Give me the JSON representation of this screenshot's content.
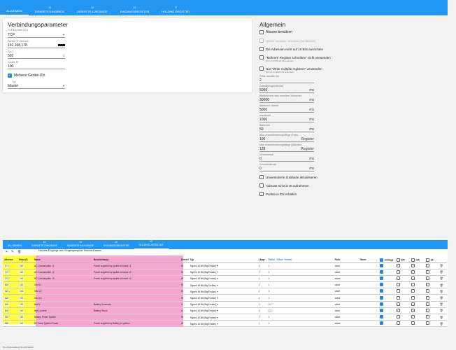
{
  "top_tabs": [
    {
      "label": "ALLGEMEIN",
      "count": "",
      "active": true
    },
    {
      "label": "DISKRETE EINGÄNGE",
      "count": "10",
      "active": false
    },
    {
      "label": "DISKRETE AUSGÄNGE",
      "count": "10",
      "active": false
    },
    {
      "label": "EINGANGSREGISTER",
      "count": "10",
      "active": false
    },
    {
      "label": "HOLDING-REGISTER",
      "count": "12",
      "active": false
    }
  ],
  "connection": {
    "title": "Verbindungsparameter",
    "subtitle": "TCP/Encoder RTU",
    "type_value": "TCP",
    "ip_label": "Partner IP-Adresse",
    "ip_value": "192.168.178.",
    "port_label": "Port",
    "port_value": "502",
    "device_label": "Geräte ID",
    "device_value": "100",
    "multi_label": "Mehrere Geräte-IDs",
    "type2_label": "Typ",
    "type2_value": "Master"
  },
  "general": {
    "title": "Allgemein",
    "aliases": "Aliasse benutzen",
    "direct": "Direkte Adressen benutzen (bei Aliasse)",
    "align": "Die Adressen nicht auf 16 Bits ausrichten",
    "multi_write": "\"Mehrere Register schreiben\" nicht verwenden",
    "multi_write_note": "Nur mit FC5/FC16 verwenden",
    "only_write": "Nur \"Write multiple registers\" verwenden",
    "only_write_note": "Nur mit FC15/FC16 schreiben",
    "fields": [
      {
        "label": "Fehler senden bei",
        "value": "2",
        "unit": ""
      },
      {
        "label": "Datenabfrageintervall",
        "value": "5000",
        "unit": "ms"
      },
      {
        "label": "Wiederholen nach erneuten Versuchen",
        "value": "30000",
        "unit": "ms"
      },
      {
        "label": "Wartezeit Lesend",
        "value": "5000",
        "unit": "ms"
      },
      {
        "label": "Impulszeit",
        "value": "1000",
        "unit": "ms"
      },
      {
        "label": "Wartezeit",
        "value": "50",
        "unit": "ms"
      },
      {
        "label": "Max Leseanforderungslänge (Polls)",
        "value": "100",
        "unit": "Register"
      },
      {
        "label": "Max Leseanforderungslänge (Bitbreite)",
        "value": "128",
        "unit": "Register"
      },
      {
        "label": "Umrechnend",
        "value": "0",
        "unit": "ms"
      },
      {
        "label": "Schreibintervall",
        "value": "0",
        "unit": "ms"
      }
    ],
    "unchanged": "Unveränderte Zustände aktualisieren",
    "no_address": "Adresse nicht in ID aufnehmen",
    "points": "Punkte in IDs erhalten"
  },
  "bottom_tabs": [
    {
      "label": "ALLGEMEIN",
      "count": "",
      "active": false
    },
    {
      "label": "DISKRETE EINGÄNGE",
      "count": "10",
      "active": false
    },
    {
      "label": "DISKRETE AUSGÄNGE",
      "count": "10",
      "active": false
    },
    {
      "label": "EINGANGSREGISTER",
      "count": "10",
      "active": false
    },
    {
      "label": "HOLDING-REGISTER",
      "count": "12",
      "active": true
    }
  ],
  "toolbar": {
    "add": "+",
    "edit": "✎",
    "delete": "🗑",
    "label": "Diskrete Eingänge bzw. Eingangsregister Standard lassen"
  },
  "columns": [
    "Adresse",
    "Slave-ID",
    "Name",
    "Beschreibung",
    "Einheit",
    "Typ",
    "Länge",
    "Faktor",
    "Offset",
    "Formel",
    "Rolle",
    "Raum",
    "Umfrage",
    "WP",
    "CW",
    "SF"
  ],
  "rows": [
    {
      "addr": "371",
      "slave": "100",
      "name": "AC Consumption L1",
      "desc": "Power supplied by system to loads L1",
      "unit": "W",
      "type": "Signed 16 Bit (Big Endian)",
      "len": "1",
      "factor": "1"
    },
    {
      "addr": "372",
      "slave": "100",
      "name": "AC Consumption L2",
      "desc": "Power supplied by system to loads L2",
      "unit": "W",
      "type": "Signed 16 Bit (Big Endian)",
      "len": "1",
      "factor": "1"
    },
    {
      "addr": "373",
      "slave": "100",
      "name": "AC Consumption L3",
      "desc": "Power supplied by system to loads L3",
      "unit": "W",
      "type": "Signed 16 Bit (Big Endian)",
      "len": "1",
      "factor": "1"
    },
    {
      "addr": "820",
      "slave": "100",
      "name": "Grid L1",
      "desc": "",
      "unit": "W",
      "type": "Signed 16 Bit (Big Endian)",
      "len": "1",
      "factor": "1"
    },
    {
      "addr": "821",
      "slave": "100",
      "name": "Grid L2",
      "desc": "",
      "unit": "W",
      "type": "Signed 16 Bit (Big Endian)",
      "len": "1",
      "factor": "1"
    },
    {
      "addr": "822",
      "slave": "100",
      "name": "Grid L3",
      "desc": "",
      "unit": "W",
      "type": "Signed 16 Bit (Big Endian)",
      "len": "1",
      "factor": "1"
    },
    {
      "addr": "840",
      "slave": "100",
      "name": "Batt V",
      "desc": "Battery Summary",
      "unit": "V",
      "type": "Signed 16 Bit (Big Endian)",
      "len": "1",
      "factor": "0.1"
    },
    {
      "addr": "841",
      "slave": "100",
      "name": "Batt_current",
      "desc": "Battery Strom",
      "unit": "A",
      "type": "Signed 16 Bit (Big Endian)",
      "len": "1",
      "factor": "0.1"
    },
    {
      "addr": "842",
      "slave": "100",
      "name": "Battery Power system",
      "desc": "",
      "unit": "W",
      "type": "Signed 16 Bit (Big Endian)",
      "len": "1",
      "factor": "1"
    },
    {
      "addr": "860",
      "slave": "100",
      "name": "DC Solar System Power",
      "desc": "Power supplied by Battery to system",
      "unit": "W",
      "type": "Signed 16 Bit (Big Endian)",
      "len": "1",
      "factor": "1"
    }
  ],
  "row_defaults": {
    "role": "value"
  },
  "footer": "Ihre Rückmeldung ist erforderlich"
}
